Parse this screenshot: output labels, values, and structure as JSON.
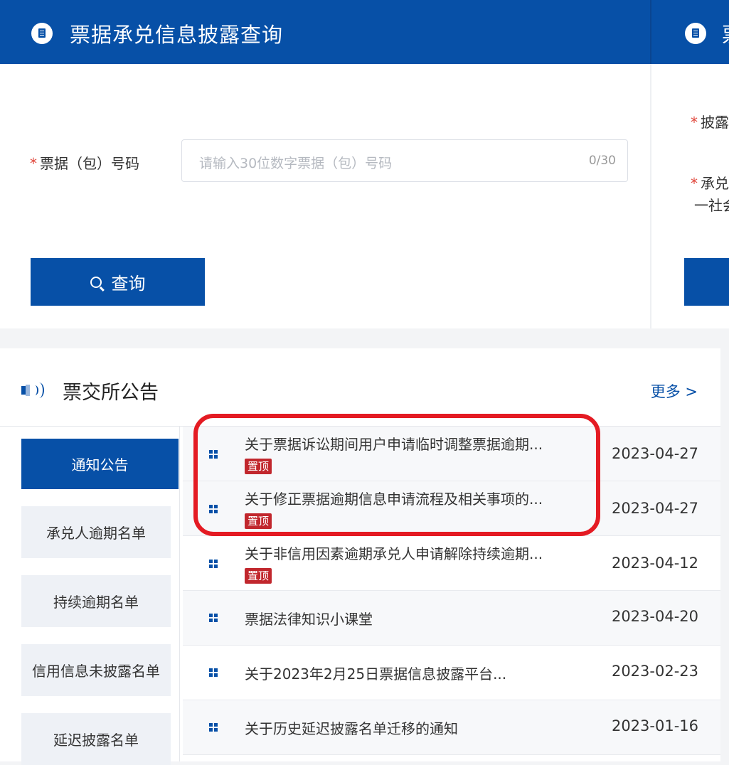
{
  "query_panel": {
    "title": "票据承兑信息披露查询",
    "field_required_mark": "*",
    "field_label": "票据（包）号码",
    "input_placeholder": "请输入30位数字票据（包）号码",
    "input_counter": "0/30",
    "query_button_label": "查询"
  },
  "second_panel": {
    "title_partial": "票",
    "label1_partial": "披露",
    "label2_partial": "承兑",
    "label3_partial": "一社会"
  },
  "notice_panel": {
    "title": "票交所公告",
    "more_label": "更多 >",
    "tabs": [
      {
        "label": "通知公告",
        "active": true
      },
      {
        "label": "承兑人逾期名单",
        "active": false
      },
      {
        "label": "持续逾期名单",
        "active": false
      },
      {
        "label": "信用信息未披露名单",
        "active": false
      },
      {
        "label": "延迟披露名单",
        "active": false
      }
    ],
    "items": [
      {
        "title": "关于票据诉讼期间用户申请临时调整票据逾期...",
        "pinned": "置顶",
        "date": "2023-04-27"
      },
      {
        "title": "关于修正票据逾期信息申请流程及相关事项的...",
        "pinned": "置顶",
        "date": "2023-04-27"
      },
      {
        "title": "关于非信用因素逾期承兑人申请解除持续逾期...",
        "pinned": "置顶",
        "date": "2023-04-12"
      },
      {
        "title": "票据法律知识小课堂",
        "pinned": "",
        "date": "2023-04-20"
      },
      {
        "title": "关于2023年2月25日票据信息披露平台...",
        "pinned": "",
        "date": "2023-02-23"
      },
      {
        "title": "关于历史延迟披露名单迁移的通知",
        "pinned": "",
        "date": "2023-01-16"
      }
    ]
  },
  "colors": {
    "brand_blue": "#0750a7",
    "pin_red": "#c1272d",
    "highlight_red": "#e41b23"
  }
}
